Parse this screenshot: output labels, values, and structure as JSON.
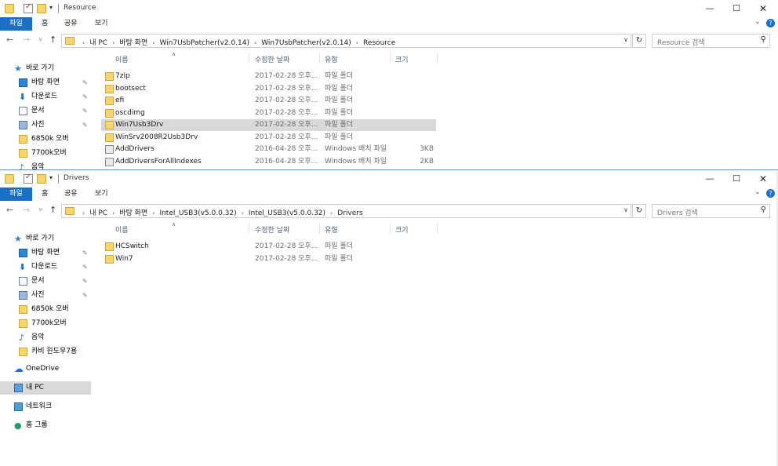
{
  "common": {
    "ribbon_tabs": [
      "파일",
      "홈",
      "공유",
      "보기"
    ],
    "columns": {
      "name": "이름",
      "date": "수정한 날짜",
      "type": "유형",
      "size": "크기"
    },
    "window_controls": {
      "minimize": "—",
      "maximize": "☐",
      "close": "✕"
    },
    "quick_access_dropdown": "▾",
    "ribbon_expand": "⌄",
    "ribbon_help": "?"
  },
  "window1": {
    "title": "Resource",
    "breadcrumbs": [
      "내 PC",
      "바탕 화면",
      "Win7UsbPatcher(v2.0.14)",
      "Win7UsbPatcher(v2.0.14)",
      "Resource"
    ],
    "search_placeholder": "Resource 검색",
    "sidebar": [
      {
        "label": "바로 가기",
        "icon": "star-icon",
        "pinned": false
      },
      {
        "label": "바탕 화면",
        "icon": "desktop-icon",
        "pinned": true
      },
      {
        "label": "다운로드",
        "icon": "download-icon",
        "pinned": true
      },
      {
        "label": "문서",
        "icon": "document-icon",
        "pinned": true
      },
      {
        "label": "사진",
        "icon": "pictures-icon",
        "pinned": true
      },
      {
        "label": "6850k 오버",
        "icon": "folder-icon",
        "pinned": false
      },
      {
        "label": "7700k오버",
        "icon": "folder-icon",
        "pinned": false
      },
      {
        "label": "음악",
        "icon": "music-icon",
        "pinned": false
      }
    ],
    "files": [
      {
        "name": "7zip",
        "date": "2017-02-28 오후...",
        "type": "파일 폴더",
        "size": "",
        "icon": "folder-icon",
        "selected": false
      },
      {
        "name": "bootsect",
        "date": "2017-02-28 오후...",
        "type": "파일 폴더",
        "size": "",
        "icon": "folder-icon",
        "selected": false
      },
      {
        "name": "efi",
        "date": "2017-02-28 오후...",
        "type": "파일 폴더",
        "size": "",
        "icon": "folder-icon",
        "selected": false
      },
      {
        "name": "oscdimg",
        "date": "2017-02-28 오후...",
        "type": "파일 폴더",
        "size": "",
        "icon": "folder-icon",
        "selected": false
      },
      {
        "name": "Win7Usb3Drv",
        "date": "2017-02-28 오후...",
        "type": "파일 폴더",
        "size": "",
        "icon": "folder-icon",
        "selected": true
      },
      {
        "name": "WinSrv2008R2Usb3Drv",
        "date": "2017-02-28 오후...",
        "type": "파일 폴더",
        "size": "",
        "icon": "folder-icon",
        "selected": false
      },
      {
        "name": "AddDrivers",
        "date": "2016-04-28 오후...",
        "type": "Windows 배치 파일",
        "size": "3KB",
        "icon": "batch-file-icon",
        "selected": false
      },
      {
        "name": "AddDriversForAllIndexes",
        "date": "2016-04-28 오후...",
        "type": "Windows 배치 파일",
        "size": "2KB",
        "icon": "batch-file-icon",
        "selected": false
      }
    ]
  },
  "window2": {
    "title": "Drivers",
    "breadcrumbs": [
      "내 PC",
      "바탕 화면",
      "Intel_USB3(v5.0.0.32)",
      "Intel_USB3(v5.0.0.32)",
      "Drivers"
    ],
    "search_placeholder": "Drivers 검색",
    "sidebar": [
      {
        "label": "바로 가기",
        "icon": "star-icon",
        "pinned": false
      },
      {
        "label": "바탕 화면",
        "icon": "desktop-icon",
        "pinned": true
      },
      {
        "label": "다운로드",
        "icon": "download-icon",
        "pinned": true
      },
      {
        "label": "문서",
        "icon": "document-icon",
        "pinned": true
      },
      {
        "label": "사진",
        "icon": "pictures-icon",
        "pinned": true
      },
      {
        "label": "6850k 오버",
        "icon": "folder-icon",
        "pinned": false
      },
      {
        "label": "7700k오버",
        "icon": "folder-icon",
        "pinned": false
      },
      {
        "label": "음악",
        "icon": "music-icon",
        "pinned": false
      },
      {
        "label": "카비 윈도우7용",
        "icon": "folder-icon",
        "pinned": false
      },
      {
        "label": "OneDrive",
        "icon": "onedrive-icon",
        "pinned": false
      },
      {
        "label": "내 PC",
        "icon": "pc-icon",
        "pinned": false,
        "selected": true
      },
      {
        "label": "네트워크",
        "icon": "network-icon",
        "pinned": false
      },
      {
        "label": "홈 그룹",
        "icon": "homegroup-icon",
        "pinned": false
      }
    ],
    "files": [
      {
        "name": "HCSwitch",
        "date": "2017-02-28 오후...",
        "type": "파일 폴더",
        "size": "",
        "icon": "folder-icon",
        "selected": false
      },
      {
        "name": "Win7",
        "date": "2017-02-28 오후...",
        "type": "파일 폴더",
        "size": "",
        "icon": "folder-icon",
        "selected": false
      }
    ]
  }
}
